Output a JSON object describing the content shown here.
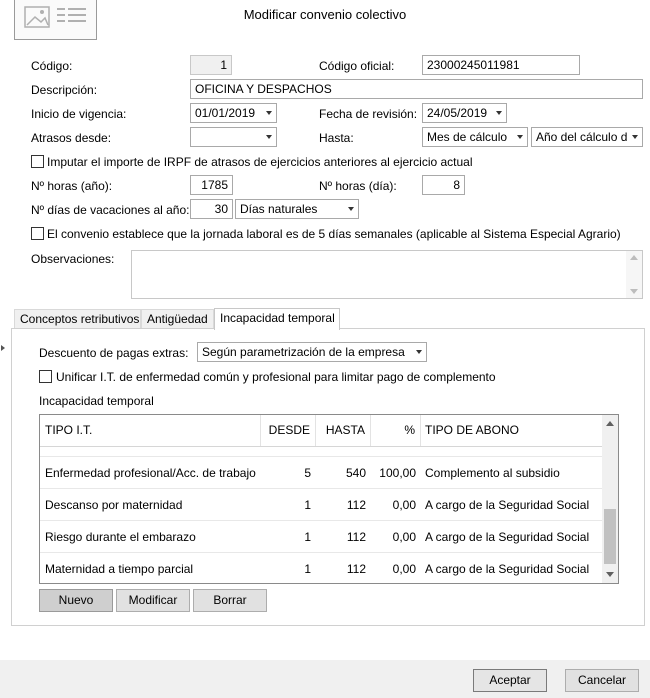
{
  "window": {
    "title": "Modificar convenio colectivo",
    "image_icon": "document-image-icon"
  },
  "form": {
    "codigo_label": "Código:",
    "codigo_value": "1",
    "codigo_oficial_label": "Código oficial:",
    "codigo_oficial_value": "23000245011981",
    "descripcion_label": "Descripción:",
    "descripcion_value": "OFICINA Y DESPACHOS",
    "inicio_label": "Inicio de vigencia:",
    "inicio_value": "01/01/2019",
    "revision_label": "Fecha de revisión:",
    "revision_value": "24/05/2019",
    "atrasos_label": "Atrasos desde:",
    "atrasos_value": "",
    "hasta_label": "Hasta:",
    "hasta_value_1": "Mes de cálculo",
    "hasta_value_2": "Año del cálculo d",
    "irpf_label": "Imputar el importe de IRPF de atrasos de ejercicios anteriores al ejercicio actual",
    "horas_anio_label": "Nº horas (año):",
    "horas_anio_value": "1785",
    "horas_dia_label": "Nº horas (día):",
    "horas_dia_value": "8",
    "vacaciones_label": "Nº días de vacaciones al año:",
    "vacaciones_value": "30",
    "vacaciones_tipo": "Días naturales",
    "jornada_label": "El convenio establece que la jornada laboral es de 5 días semanales (aplicable al Sistema Especial Agrario)",
    "observaciones_label": "Observaciones:",
    "observaciones_value": ""
  },
  "tabs": [
    {
      "label": "Conceptos retributivos"
    },
    {
      "label": "Antigüedad"
    },
    {
      "label": "Incapacidad temporal"
    }
  ],
  "it_panel": {
    "descuento_label": "Descuento de pagas extras:",
    "descuento_value": "Según parametrización de la empresa",
    "unificar_label": "Unificar I.T. de enfermedad común y profesional para limitar pago de complemento",
    "group_label": "Incapacidad temporal",
    "columns": [
      "TIPO I.T.",
      "DESDE",
      "HASTA",
      "%",
      "TIPO DE ABONO"
    ],
    "rows": [
      {
        "tipo": "Enfermedad profesional/Acc. de trabajo",
        "desde": "5",
        "hasta": "540",
        "pct": "100,00",
        "abono": "Complemento al subsidio"
      },
      {
        "tipo": "Descanso por maternidad",
        "desde": "1",
        "hasta": "112",
        "pct": "0,00",
        "abono": "A cargo de la Seguridad Social"
      },
      {
        "tipo": "Riesgo durante el embarazo",
        "desde": "1",
        "hasta": "112",
        "pct": "0,00",
        "abono": "A cargo de la Seguridad Social"
      },
      {
        "tipo": "Maternidad a tiempo parcial",
        "desde": "1",
        "hasta": "112",
        "pct": "0,00",
        "abono": "A cargo de la Seguridad Social"
      }
    ],
    "buttons": {
      "nuevo": "Nuevo",
      "modificar": "Modificar",
      "borrar": "Borrar"
    }
  },
  "footer": {
    "aceptar": "Aceptar",
    "cancelar": "Cancelar"
  },
  "colors": {
    "window_bg": "#ffffff",
    "footer_bg": "#f0f0f0",
    "border": "#a9a9a9",
    "button_bg": "#e1e1e1"
  }
}
